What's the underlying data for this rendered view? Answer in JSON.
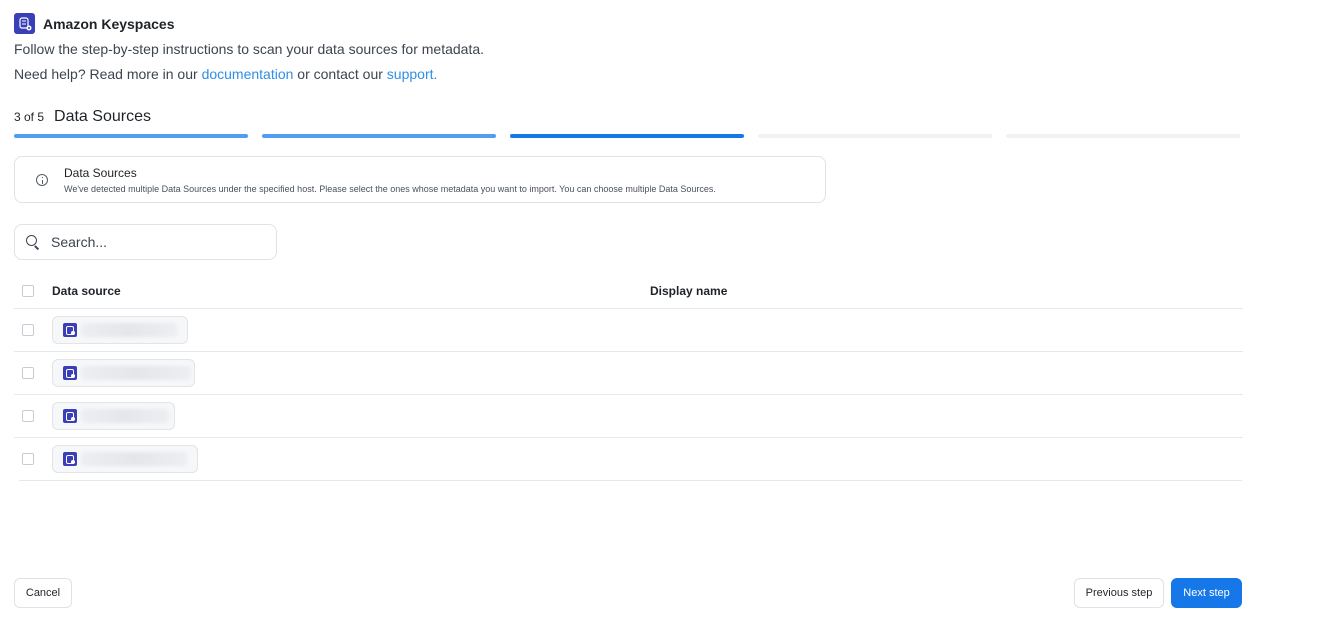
{
  "header": {
    "app_title": "Amazon Keyspaces",
    "app_icon": "keyspaces-database-icon"
  },
  "intro": {
    "text": "Follow the step-by-step instructions to scan your data sources for metadata.",
    "help_prefix": "Need help? Read more in our ",
    "documentation_link": "documentation",
    "help_middle": " or contact our ",
    "support_link": "support."
  },
  "stepper": {
    "count_label": "3 of 5",
    "title": "Data Sources",
    "current": 3,
    "total": 5
  },
  "info": {
    "title": "Data Sources",
    "text": "We've detected multiple Data Sources under the specified host. Please select the ones whose metadata you want to import. You can choose multiple Data Sources."
  },
  "search": {
    "placeholder": "Search..."
  },
  "table": {
    "columns": [
      "Data source",
      "Display name"
    ],
    "rows": [
      {
        "checked": false,
        "data_source": "",
        "display_name": ""
      },
      {
        "checked": false,
        "data_source": "",
        "display_name": ""
      },
      {
        "checked": false,
        "data_source": "",
        "display_name": ""
      },
      {
        "checked": false,
        "data_source": "",
        "display_name": ""
      }
    ]
  },
  "footer": {
    "cancel_label": "Cancel",
    "previous_label": "Previous step",
    "next_label": "Next step"
  },
  "colors": {
    "accent": "#1677e8",
    "link": "#2f8fe6",
    "brand_icon": "#3a3fb8"
  }
}
